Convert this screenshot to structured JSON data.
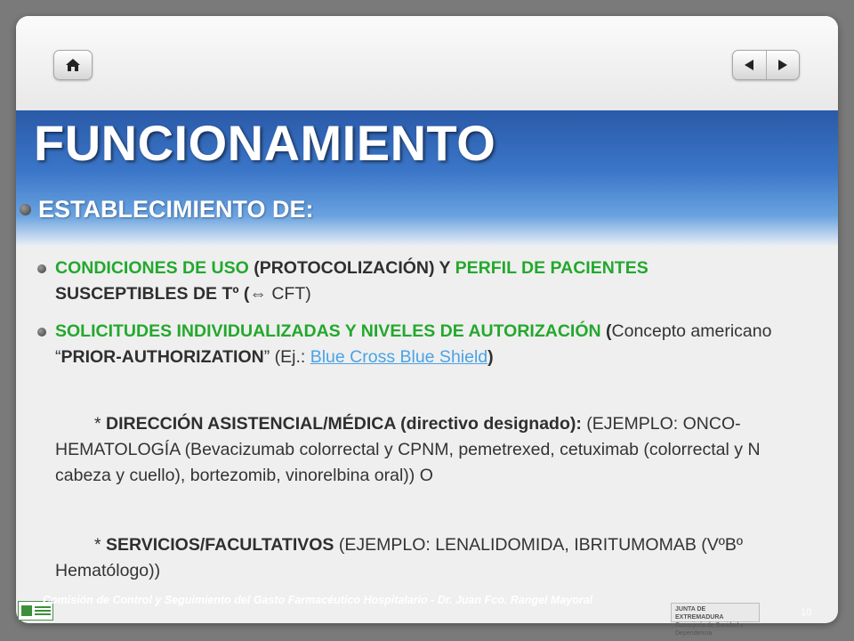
{
  "nav": {
    "home_icon": "home-icon",
    "prev_icon": "triangle-left-icon",
    "next_icon": "triangle-right-icon"
  },
  "slide": {
    "title": "FUNCIONAMIENTO",
    "level1": "ESTABLECIMIENTO DE:",
    "item1": {
      "a": "CONDICIONES DE USO",
      "b": " (PROTOCOLIZACIÓN) Y ",
      "c": "PERFIL DE PACIENTES",
      "d": " SUSCEPTIBLES DE Tº (",
      "arrow": "⇔",
      "e": " CFT)"
    },
    "item2": {
      "a": "SOLICITUDES INDIVIDUALIZADAS Y NIVELES DE AUTORIZACIÓN",
      "b": " (",
      "c": "Concepto americano “",
      "d": "PRIOR-AUTHORIZATION",
      "e": "” (Ej.: ",
      "link": "Blue Cross Blue Shield",
      "f": ")"
    },
    "item3": {
      "a": "* ",
      "b": "DIRECCIÓN ASISTENCIAL/MÉDICA (directivo designado):",
      "c": " (EJEMPLO: ONCO-HEMATOLOGÍA (Bevacizumab colorrectal y CPNM, pemetrexed, cetuximab (colorrectal y N cabeza y cuello), bortezomib, vinorelbina oral)) O"
    },
    "item4": {
      "a": "* ",
      "b": "SERVICIOS/FACULTATIVOS",
      "c": " (EJEMPLO: LENALIDOMIDA, IBRITUMOMAB (VºBº Hematólogo))"
    }
  },
  "footer": {
    "text": "Comisión de Control  y Seguimiento del Gasto Farmacéutico Hospitalario - Dr. Juan Fco. Rangel Mayoral",
    "logo_right_line1": "JUNTA DE EXTREMADURA",
    "logo_right_line2": "Consejería de Sanidad y Dependencia",
    "page_number": "10"
  }
}
